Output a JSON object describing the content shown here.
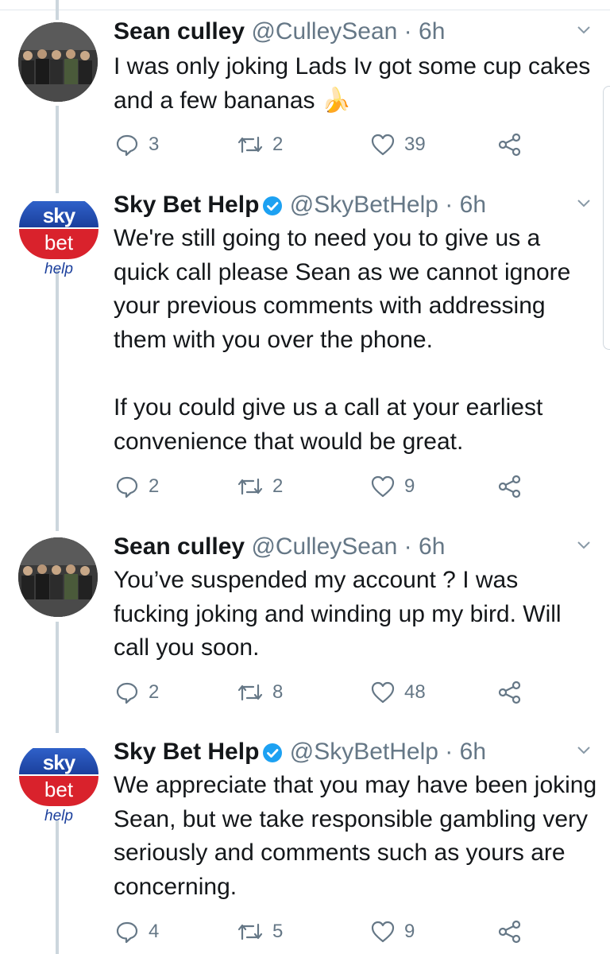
{
  "tweets": [
    {
      "author": "Sean culley",
      "handle": "@CulleySean",
      "time": "6h",
      "verified": false,
      "avatar": "group-photo",
      "text": "I was only joking Lads Iv got some cup cakes and a few bananas 🍌",
      "replies": "3",
      "retweets": "2",
      "likes": "39"
    },
    {
      "author": "Sky Bet Help",
      "handle": "@SkyBetHelp",
      "time": "6h",
      "verified": true,
      "avatar": "skybet-logo",
      "text_lines": [
        "We're still going to need you to give us a quick call please Sean as we cannot ignore your previous comments with addressing them with you over the phone.",
        "If you could give us a call at your earliest convenience that would be great."
      ],
      "replies": "2",
      "retweets": "2",
      "likes": "9"
    },
    {
      "author": "Sean culley",
      "handle": "@CulleySean",
      "time": "6h",
      "verified": false,
      "avatar": "group-photo",
      "text": "You’ve suspended my account ? I was fucking joking and winding up my bird. Will call you soon.",
      "replies": "2",
      "retweets": "8",
      "likes": "48"
    },
    {
      "author": "Sky Bet Help",
      "handle": "@SkyBetHelp",
      "time": "6h",
      "verified": true,
      "avatar": "skybet-logo",
      "text": "We appreciate that you may have been joking Sean, but we take responsible gambling very seriously and comments such as yours are concerning.",
      "replies": "4",
      "retweets": "5",
      "likes": "9"
    }
  ],
  "logo": {
    "sky": "sky",
    "bet": "bet",
    "help": "help"
  },
  "separator": "·",
  "icons": [
    "reply-icon",
    "retweet-icon",
    "like-icon",
    "share-icon",
    "chevron-down-icon",
    "verified-icon"
  ],
  "colors": {
    "text": "#14171a",
    "secondary": "#657786",
    "verified": "#1da1f2",
    "thread": "#ccd6dd",
    "skyBlue": "#1b3f9c",
    "betRed": "#d9222c"
  }
}
